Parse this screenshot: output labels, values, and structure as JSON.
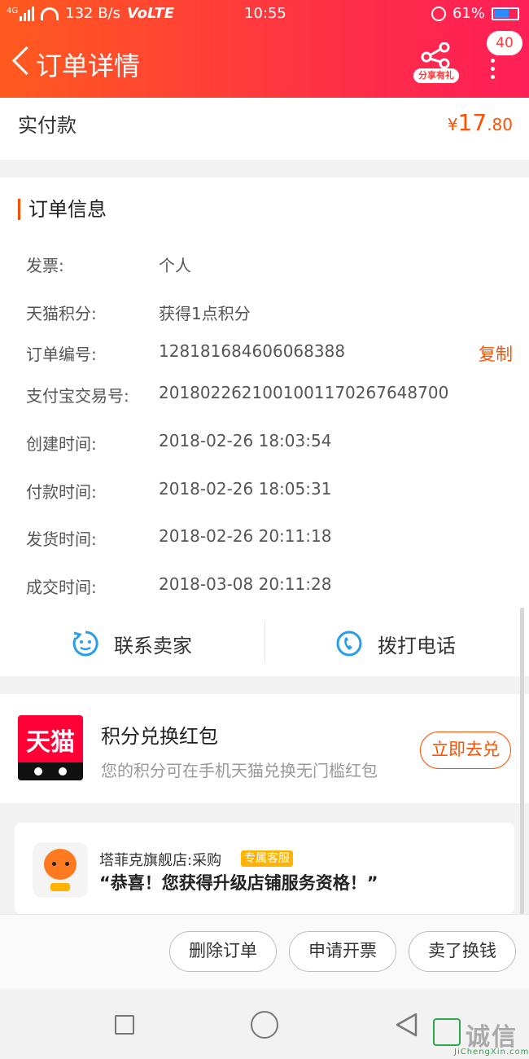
{
  "status_bar": {
    "network": "4G",
    "speed": "132 B/s",
    "volte": "VoLTE",
    "time": "10:55",
    "battery": "61%",
    "battery_level": 0.61
  },
  "nav": {
    "title": "订单详情",
    "share_label": "分享有礼",
    "badge_count": "40"
  },
  "paid": {
    "label": "实付款",
    "currency": "¥",
    "integer": "17",
    "decimal": ".80"
  },
  "order_info": {
    "title": "订单信息",
    "rows": [
      {
        "key": "发票:",
        "value": "个人"
      },
      {
        "key": "天猫积分:",
        "value": "获得1点积分"
      },
      {
        "key": "订单编号:",
        "value": "128181684606068388",
        "action": "复制"
      },
      {
        "key": "支付宝交易号:",
        "value": "2018022621001001170267648700"
      },
      {
        "key": "创建时间:",
        "value": "2018-02-26 18:03:54"
      },
      {
        "key": "付款时间:",
        "value": "2018-02-26 18:05:31"
      },
      {
        "key": "发货时间:",
        "value": "2018-02-26 20:11:18"
      },
      {
        "key": "成交时间:",
        "value": "2018-03-08 20:11:28"
      }
    ],
    "contact_seller": "联系卖家",
    "call_phone": "拨打电话"
  },
  "tmall_card": {
    "logo_text": "天猫",
    "title": "积分兑换红包",
    "subtitle": "您的积分可在手机天猫兑换无门槛红包",
    "button": "立即去兑"
  },
  "service_card": {
    "shop": "塔菲克旗舰店:采购",
    "tag": "专属客服",
    "message": "“恭喜！您获得升级店铺服务资格！”"
  },
  "actions": {
    "delete": "删除订单",
    "invoice": "申请开票",
    "sell": "卖了换钱"
  },
  "watermark": {
    "text": "诚信",
    "url": "JiChengXin.com"
  },
  "colors": {
    "accent": "#ff5000",
    "header_start": "#ff5a1e",
    "header_end": "#ff1f56",
    "tmall_red": "#ff0036",
    "icon_blue": "#2a9de8"
  }
}
